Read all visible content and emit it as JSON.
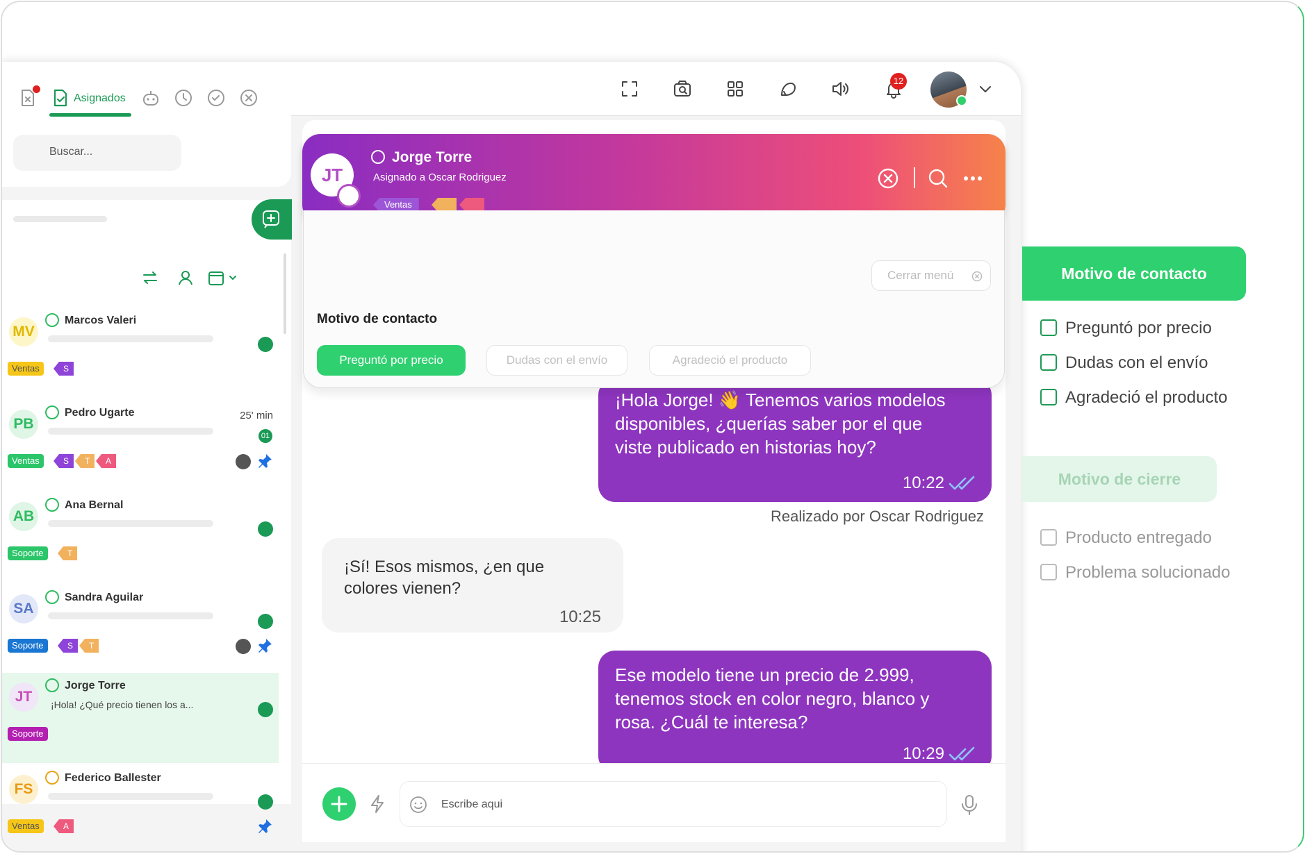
{
  "colors": {
    "brand_green": "#1a9a55",
    "accent_green": "#2fd06f",
    "bubble_purple": "#8e35bf",
    "badge_red": "#e0201f"
  },
  "topbar": {
    "icons": [
      "fullscreen-icon",
      "screen-search-icon",
      "grid-apps-icon",
      "support-icon",
      "speaker-icon",
      "bell-icon",
      "chevron-down-icon"
    ],
    "notifications_count": "12"
  },
  "sidebar": {
    "tabs": [
      {
        "icon": "file-x-icon",
        "has_alert_dot": true
      },
      {
        "icon": "file-check-icon",
        "label": "Asignados",
        "active": true
      },
      {
        "icon": "bot-icon"
      },
      {
        "icon": "clock-icon"
      },
      {
        "icon": "check-circle-icon"
      },
      {
        "icon": "x-circle-icon"
      }
    ],
    "search_placeholder": "Buscar...",
    "contacts": [
      {
        "initials": "MV",
        "name": "Marcos Valeri",
        "time": "",
        "preview": "",
        "channel_tag": "Ventas",
        "tags": [
          "S"
        ],
        "unread": "",
        "emoji_color": "green"
      },
      {
        "initials": "PB",
        "name": "Pedro Ugarte",
        "time": "25' min",
        "preview": "",
        "channel_tag": "Ventas",
        "tags": [
          "S",
          "T",
          "A"
        ],
        "unread": "01",
        "emoji_color": "green"
      },
      {
        "initials": "AB",
        "name": "Ana Bernal",
        "time": "",
        "preview": "",
        "channel_tag": "Soporte",
        "tags": [
          "T"
        ],
        "unread": "",
        "emoji_color": "green"
      },
      {
        "initials": "SA",
        "name": "Sandra Aguilar",
        "time": "",
        "preview": "...",
        "channel_tag": "Soporte",
        "tags": [
          "S",
          "T"
        ],
        "unread": "",
        "emoji_color": "green"
      },
      {
        "initials": "JT",
        "name": "Jorge Torre",
        "time": "",
        "preview": "¡Hola! ¿Qué precio tienen los a...",
        "channel_tag": "Soporte",
        "tags": [],
        "unread": "",
        "emoji_color": "green"
      },
      {
        "initials": "FS",
        "name": "Federico Ballester",
        "time": "",
        "preview": "...",
        "channel_tag": "Ventas",
        "tags": [
          "A"
        ],
        "unread": "",
        "emoji_color": "yellow"
      }
    ]
  },
  "chat": {
    "contact": {
      "initials": "JT",
      "name": "Jorge Torre",
      "assigned": "Asignado a Oscar Rodriguez",
      "tags": [
        "Ventas",
        "",
        ""
      ]
    },
    "menu": {
      "close_label": "Cerrar menú",
      "title": "Motivo de contacto",
      "options": [
        {
          "label": "Preguntó por precio",
          "selected": true
        },
        {
          "label": "Dudas con el envío",
          "selected": false
        },
        {
          "label": "Agradeció el producto",
          "selected": false
        }
      ]
    },
    "messages": [
      {
        "dir": "out",
        "lines": [
          "¡Hola Jorge! 👋 Tenemos varios modelos",
          "disponibles, ¿querías saber por el que",
          "viste publicado en historias hoy?"
        ],
        "time": "10:22"
      },
      {
        "dir": "in",
        "lines": [
          "¡Sí! Esos mismos, ¿en que",
          "colores vienen?"
        ],
        "time": "10:25"
      },
      {
        "dir": "out",
        "lines": [
          "Ese modelo tiene un precio de 2.999,",
          "tenemos stock en color negro, blanco y",
          "rosa. ¿Cuál te interesa?"
        ],
        "time": "10:29"
      }
    ],
    "done_by": "Realizado por Oscar Rodriguez",
    "composer_placeholder": "Escribe aqui"
  },
  "right_panel": {
    "contact_reason": {
      "title": "Motivo de contacto",
      "items": [
        "Preguntó por precio",
        "Dudas con el envío",
        "Agradeció el producto"
      ]
    },
    "close_reason": {
      "title": "Motivo de cierre",
      "items": [
        "Producto entregado",
        "Problema solucionado"
      ]
    }
  }
}
